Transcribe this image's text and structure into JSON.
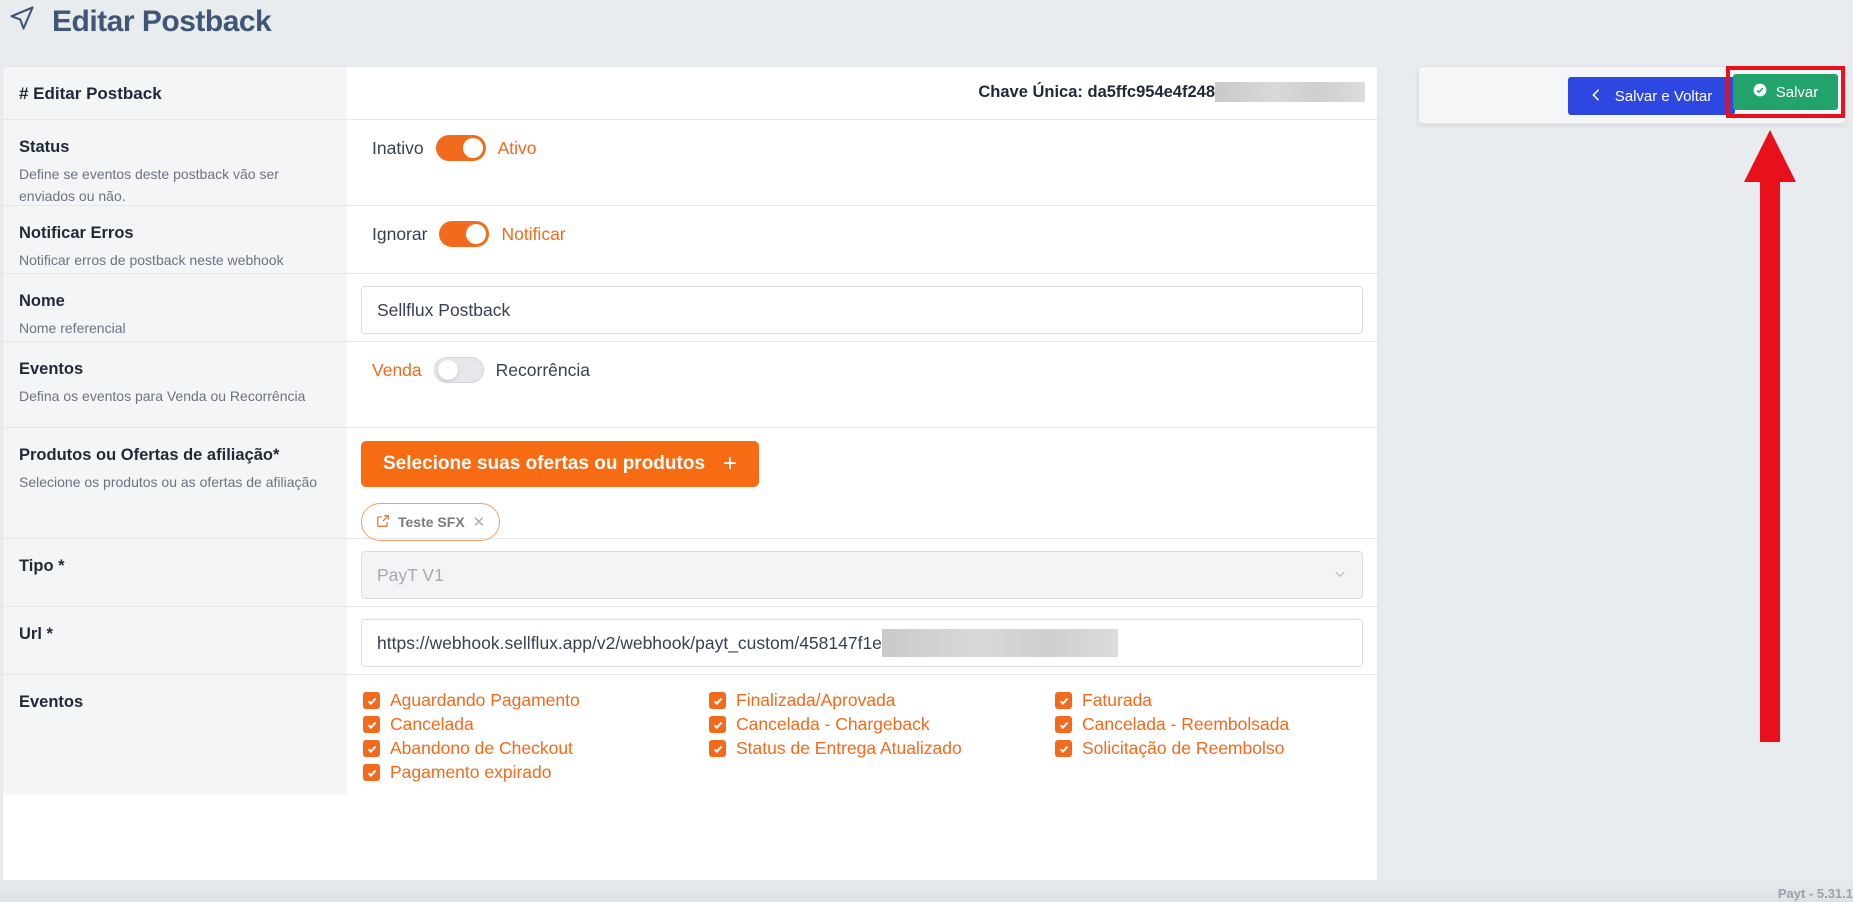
{
  "page": {
    "title": "Editar Postback",
    "title_icon": "navigation-arrow-icon"
  },
  "form": {
    "header_label": "# Editar Postback",
    "chave_label": "Chave Única: da5ffc954e4f248",
    "status": {
      "label": "Status",
      "desc": "Define se eventos deste postback vão ser enviados ou não.",
      "off_label": "Inativo",
      "on_label": "Ativo",
      "value": true
    },
    "notificar": {
      "label": "Notificar Erros",
      "desc": "Notificar erros de postback neste webhook",
      "off_label": "Ignorar",
      "on_label": "Notificar",
      "value": true
    },
    "nome": {
      "label": "Nome",
      "desc": "Nome referencial",
      "value": "Sellflux Postback"
    },
    "eventos_tipo": {
      "label": "Eventos",
      "desc": "Defina os eventos para Venda ou Recorrência",
      "left_label": "Venda",
      "right_label": "Recorrência",
      "value": false
    },
    "produtos": {
      "label": "Produtos ou Ofertas de afiliação*",
      "desc": "Selecione os produtos ou as ofertas de afiliação",
      "button_label": "Selecione suas ofertas ou produtos",
      "chip_label": "Teste SFX"
    },
    "tipo": {
      "label": "Tipo *",
      "value": "PayT V1"
    },
    "url": {
      "label": "Url *",
      "value": "https://webhook.sellflux.app/v2/webhook/payt_custom/458147f1e"
    },
    "eventos": {
      "label": "Eventos",
      "items": [
        {
          "label": "Aguardando Pagamento",
          "checked": true
        },
        {
          "label": "Finalizada/Aprovada",
          "checked": true
        },
        {
          "label": "Faturada",
          "checked": true
        },
        {
          "label": "Cancelada",
          "checked": true
        },
        {
          "label": "Cancelada - Chargeback",
          "checked": true
        },
        {
          "label": "Cancelada - Reembolsada",
          "checked": true
        },
        {
          "label": "Abandono de Checkout",
          "checked": true
        },
        {
          "label": "Status de Entrega Atualizado",
          "checked": true
        },
        {
          "label": "Solicitação de Reembolso",
          "checked": true
        },
        {
          "label": "Pagamento expirado",
          "checked": true
        }
      ]
    }
  },
  "actions": {
    "back_label": "Salvar e Voltar",
    "save_label": "Salvar"
  },
  "footer": {
    "version": "Payt - 5.31.1"
  },
  "colors": {
    "accent": "#f26a1b",
    "blue": "#2d47e0",
    "green": "#22a36b",
    "annotation_red": "#e8101b"
  }
}
